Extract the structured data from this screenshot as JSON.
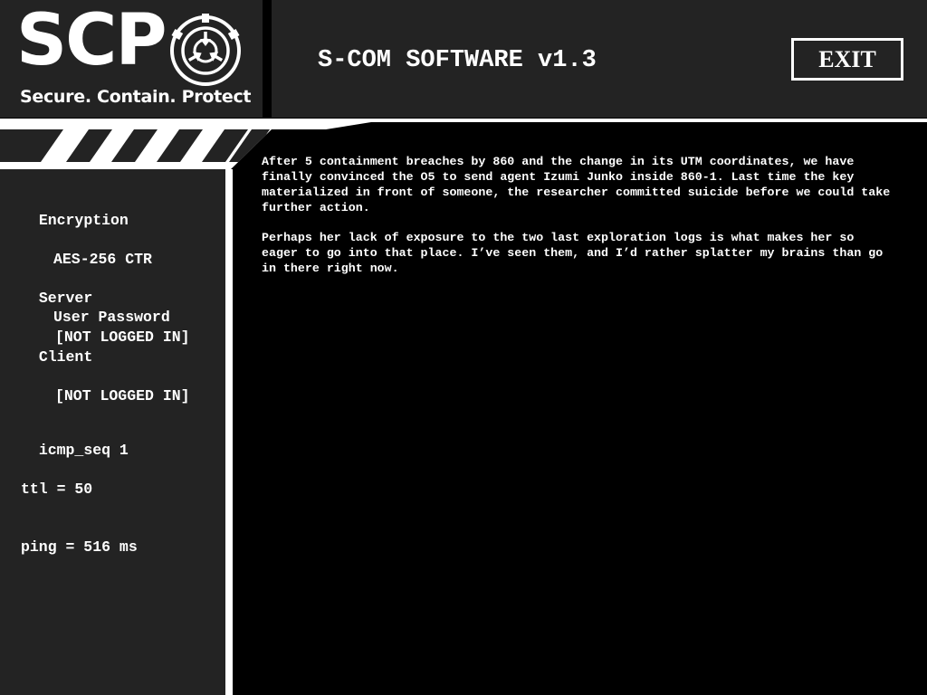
{
  "logo": {
    "wordmark": "SCP",
    "tagline": "Secure. Contain. Protect",
    "emblem_icon": "scp-emblem-icon"
  },
  "header": {
    "title": "S-COM SOFTWARE v1.3",
    "exit_label": "EXIT"
  },
  "sidebar": {
    "encryption": {
      "label": "Encryption",
      "items": [
        "AES-256 CTR",
        "User Password"
      ]
    },
    "server": {
      "label": "Server",
      "status": "[NOT LOGGED IN]"
    },
    "client": {
      "label": "Client",
      "status": "[NOT LOGGED IN]"
    },
    "stats": {
      "icmp_seq": "icmp_seq 1",
      "ttl": "ttl = 50",
      "ping": "ping = 516 ms"
    }
  },
  "main": {
    "paragraphs": [
      "After 5 containment breaches by 860 and the change in its UTM coordinates, we have finally convinced the O5 to send agent Izumi Junko inside 860-1. Last time the key materialized in front of someone, the researcher committed suicide before we could take further action.",
      "Perhaps her lack of exposure to the two last exploration logs is what makes her so eager to go into that place. I’ve seen them, and I’d rather splatter my brains than go in there right now."
    ]
  }
}
